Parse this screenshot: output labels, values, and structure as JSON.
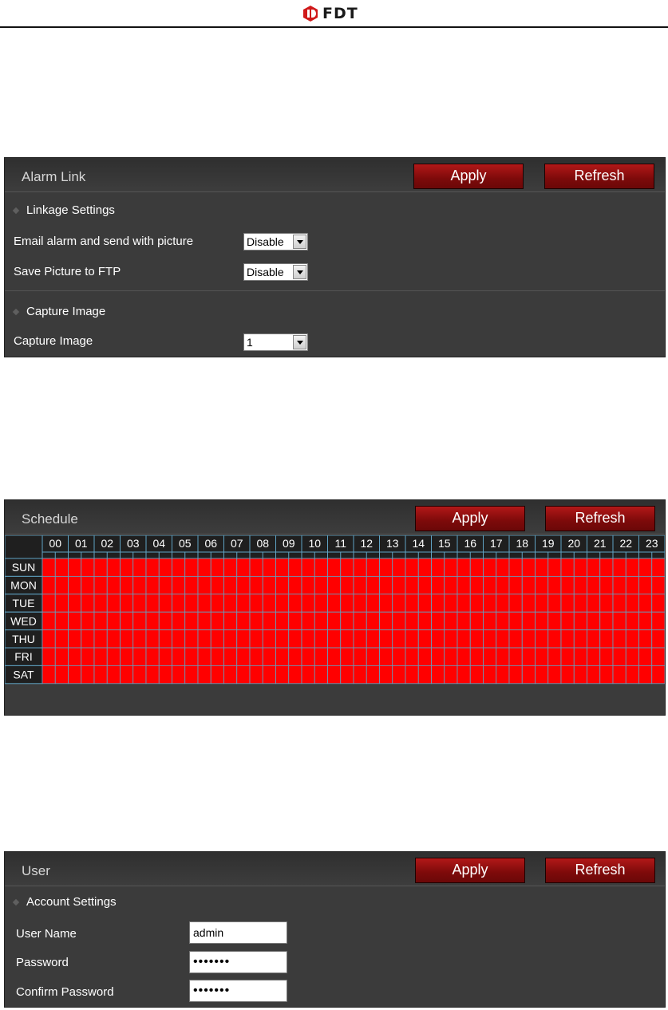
{
  "header": {
    "brand": "FDT"
  },
  "alarm_link": {
    "title": "Alarm Link",
    "apply_label": "Apply",
    "refresh_label": "Refresh",
    "linkage_heading": "Linkage Settings",
    "email_label": "Email alarm and send with picture",
    "email_value": "Disable",
    "ftp_label": "Save Picture to FTP",
    "ftp_value": "Disable",
    "capture_heading": "Capture Image",
    "capture_label": "Capture Image",
    "capture_value": "1"
  },
  "schedule": {
    "title": "Schedule",
    "apply_label": "Apply",
    "refresh_label": "Refresh",
    "hours": [
      "00",
      "01",
      "02",
      "03",
      "04",
      "05",
      "06",
      "07",
      "08",
      "09",
      "10",
      "11",
      "12",
      "13",
      "14",
      "15",
      "16",
      "17",
      "18",
      "19",
      "20",
      "21",
      "22",
      "23"
    ],
    "days": [
      "SUN",
      "MON",
      "TUE",
      "WED",
      "THU",
      "FRI",
      "SAT"
    ],
    "slot_color": "#ff0000",
    "grid_line_color": "#5fa3c4"
  },
  "user": {
    "title": "User",
    "apply_label": "Apply",
    "refresh_label": "Refresh",
    "account_heading": "Account Settings",
    "username_label": "User Name",
    "username_value": "admin",
    "password_label": "Password",
    "password_value": "•••••••",
    "confirm_label": "Confirm Password",
    "confirm_value": "•••••••"
  }
}
